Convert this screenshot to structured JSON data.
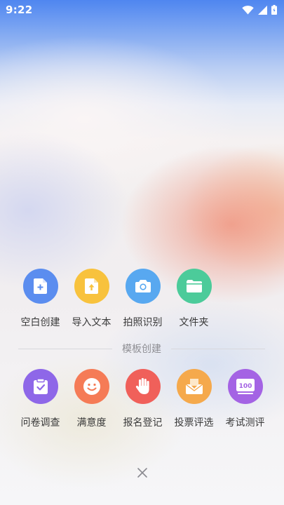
{
  "status_bar": {
    "time": "9:22",
    "icons": [
      "wifi-icon",
      "signal-icon",
      "battery-icon"
    ]
  },
  "quick_create": [
    {
      "label": "空白创建",
      "icon": "blank-document-plus-icon",
      "color": "#5B8DEF"
    },
    {
      "label": "导入文本",
      "icon": "import-document-upload-icon",
      "color": "#F8C23D"
    },
    {
      "label": "拍照识别",
      "icon": "camera-icon",
      "color": "#58A8F0"
    },
    {
      "label": "文件夹",
      "icon": "folder-icon",
      "color": "#4CCB9A"
    }
  ],
  "template_section": {
    "title": "模板创建"
  },
  "templates": [
    {
      "label": "问卷调查",
      "icon": "clipboard-check-icon",
      "color": "#8E67E8"
    },
    {
      "label": "满意度",
      "icon": "smiley-face-icon",
      "color": "#F57B56"
    },
    {
      "label": "报名登记",
      "icon": "raised-hand-icon",
      "color": "#F0605A"
    },
    {
      "label": "投票评选",
      "icon": "ballot-box-icon",
      "color": "#F5A94C"
    },
    {
      "label": "考试测评",
      "icon": "exam-score-icon",
      "color": "#A463E4",
      "badge": "100"
    }
  ],
  "close_icon": "close-icon"
}
